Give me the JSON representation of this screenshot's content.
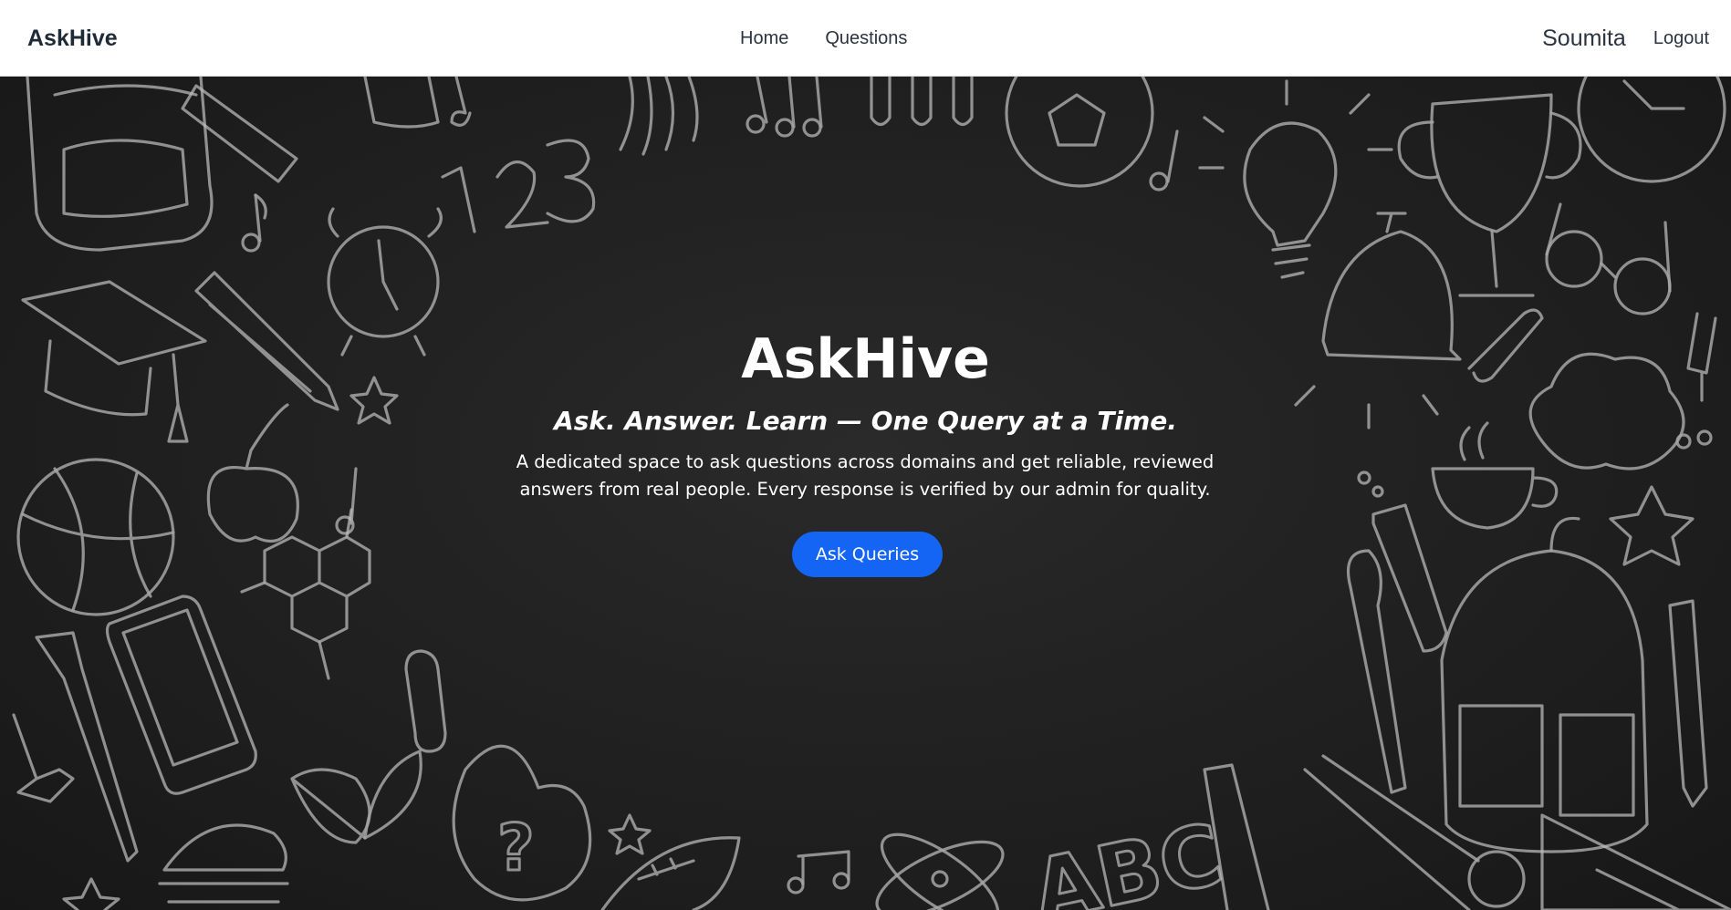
{
  "navbar": {
    "brand": "AskHive",
    "links": [
      "Home",
      "Questions"
    ],
    "username": "Soumita",
    "logout_label": "Logout"
  },
  "hero": {
    "title": "AskHive",
    "tagline": "Ask. Answer. Learn — One Query at a Time.",
    "description": "A dedicated space to ask questions across domains and get reliable, reviewed answers from real people. Every response is verified by our admin for quality.",
    "cta_label": "Ask Queries",
    "doodle_text": [
      "123",
      "ABC",
      "?"
    ]
  },
  "colors": {
    "accent": "#1565f5",
    "navbar_bg": "#ffffff",
    "hero_bg": "#1d1d1d",
    "doodle": "#bdbdbd"
  }
}
